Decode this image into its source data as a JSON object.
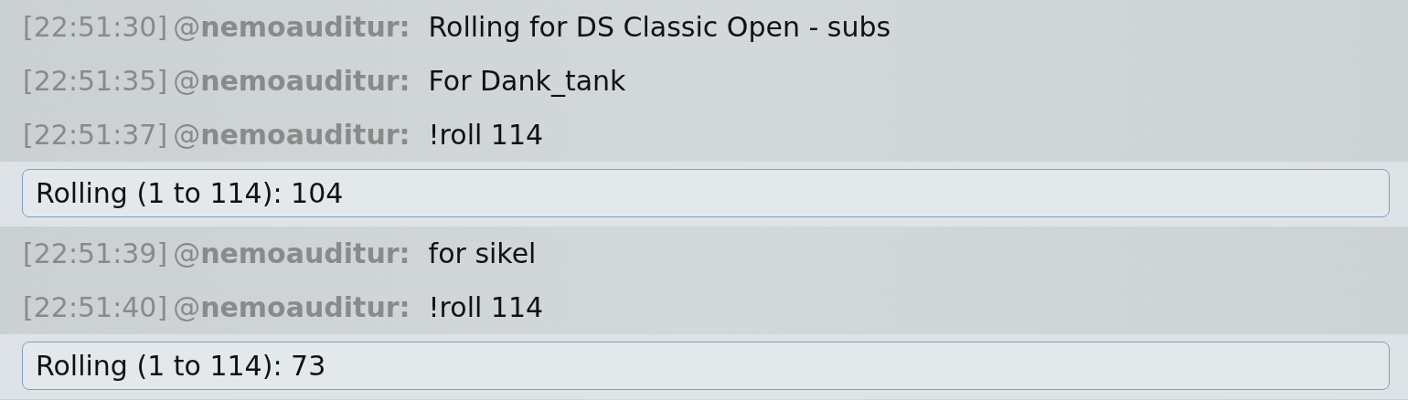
{
  "messages": [
    {
      "kind": "chat",
      "time": "[22:51:30]",
      "user": "@**nemoauditur:**",
      "text": "Rolling for DS Classic Open - subs"
    },
    {
      "kind": "chat",
      "time": "[22:51:35]",
      "user": "@**nemoauditur:**",
      "text": "For Dank_tank"
    },
    {
      "kind": "chat",
      "time": "[22:51:37]",
      "user": "@**nemoauditur:**",
      "text": "!roll 114"
    },
    {
      "kind": "bot",
      "text": "Rolling (1 to 114): 104"
    },
    {
      "kind": "chat",
      "time": "[22:51:39]",
      "user": "@**nemoauditur:**",
      "text": "for sikel"
    },
    {
      "kind": "chat",
      "time": "[22:51:40]",
      "user": "@**nemoauditur:**",
      "text": "!roll 114"
    },
    {
      "kind": "bot",
      "text": "Rolling (1 to 114): 73"
    }
  ]
}
